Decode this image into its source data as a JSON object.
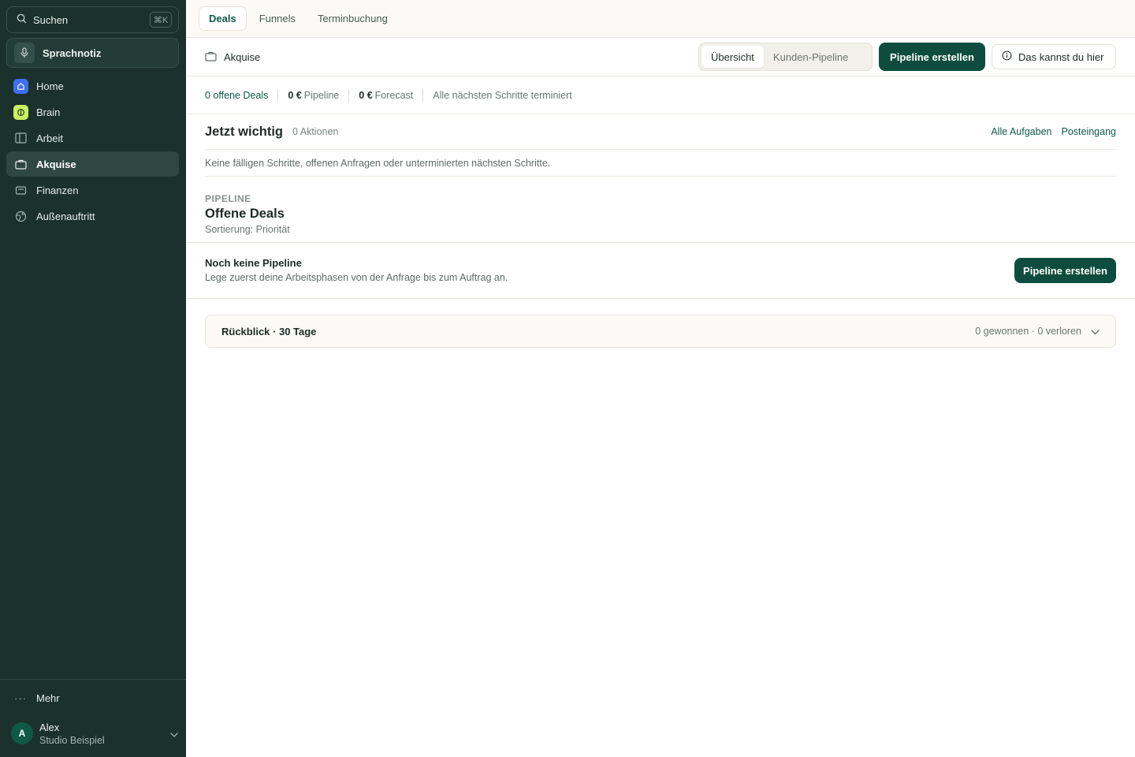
{
  "sidebar": {
    "search": {
      "label": "Suchen",
      "shortcut": "⌘K",
      "icon": "search-icon"
    },
    "voice_note": {
      "label": "Sprachnotiz",
      "icon": "mic-icon"
    },
    "items": [
      {
        "label": "Home",
        "icon": "home-icon",
        "active": false
      },
      {
        "label": "Brain",
        "icon": "brain-icon",
        "active": false
      },
      {
        "label": "Arbeit",
        "icon": "columns-icon",
        "active": false
      },
      {
        "label": "Akquise",
        "icon": "briefcase-icon",
        "active": true
      },
      {
        "label": "Finanzen",
        "icon": "wallet-icon",
        "active": false
      },
      {
        "label": "Außenauftritt",
        "icon": "globe-icon",
        "active": false
      }
    ],
    "more": {
      "label": "Mehr",
      "icon": "dots-icon"
    },
    "user": {
      "initial": "A",
      "name": "Alex",
      "org": "Studio Beispiel"
    }
  },
  "topbar": {
    "tabs": [
      {
        "label": "Deals",
        "active": true
      },
      {
        "label": "Funnels",
        "active": false
      },
      {
        "label": "Terminbuchung",
        "active": false
      }
    ]
  },
  "header": {
    "breadcrumb": "Akquise",
    "segments": [
      {
        "label": "Übersicht",
        "active": true
      },
      {
        "label": "Kunden-Pipeline",
        "active": false
      }
    ],
    "create_label": "Pipeline erstellen",
    "help_label": "Das kannst du hier"
  },
  "stats": {
    "open_deals": "0 offene Deals",
    "pipeline_value": "0 €",
    "pipeline_label": "Pipeline",
    "forecast_value": "0 €",
    "forecast_label": "Forecast",
    "next_steps": "Alle nächsten Schritte terminiert"
  },
  "now": {
    "title": "Jetzt wichtig",
    "count": "0 Aktionen",
    "link_tasks": "Alle Aufgaben",
    "link_inbox": "Posteingang",
    "empty": "Keine fälligen Schritte, offenen Anfragen oder unterminierten nächsten Schritte."
  },
  "pipeline": {
    "eyebrow": "PIPELINE",
    "title": "Offene Deals",
    "sort": "Sortierung: Priorität"
  },
  "no_pipeline": {
    "title": "Noch keine Pipeline",
    "description": "Lege zuerst deine Arbeitsphasen von der Anfrage bis zum Auftrag an.",
    "button": "Pipeline erstellen"
  },
  "review": {
    "title": "Rückblick · 30 Tage",
    "summary": "0 gewonnen · 0 verloren"
  },
  "colors": {
    "sidebar_bg": "#1b322c",
    "primary": "#0e4d3d",
    "accent_text": "#0e5a47",
    "home_icon": "#3f6ff0",
    "brain_icon": "#c9f060"
  }
}
